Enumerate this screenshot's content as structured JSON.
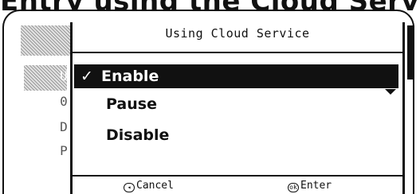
{
  "caption": "Entry using the Cloud Service(Type",
  "background": {
    "letters": [
      "U",
      "0",
      "D",
      "P"
    ]
  },
  "dialog": {
    "title": "Using Cloud Service",
    "items": [
      {
        "label": "Enable",
        "checked": true,
        "selected": true
      },
      {
        "label": "Pause",
        "checked": false,
        "selected": false
      },
      {
        "label": "Disable",
        "checked": false,
        "selected": false
      }
    ],
    "check_glyph": "✓",
    "footer": {
      "cancel_icon": "back-icon",
      "cancel_label": "Cancel",
      "enter_icon": "ok-icon",
      "enter_label": "Enter"
    }
  },
  "colors": {
    "highlight": "#111111",
    "background": "#ffffff",
    "hatch": "#9a9a9a"
  }
}
